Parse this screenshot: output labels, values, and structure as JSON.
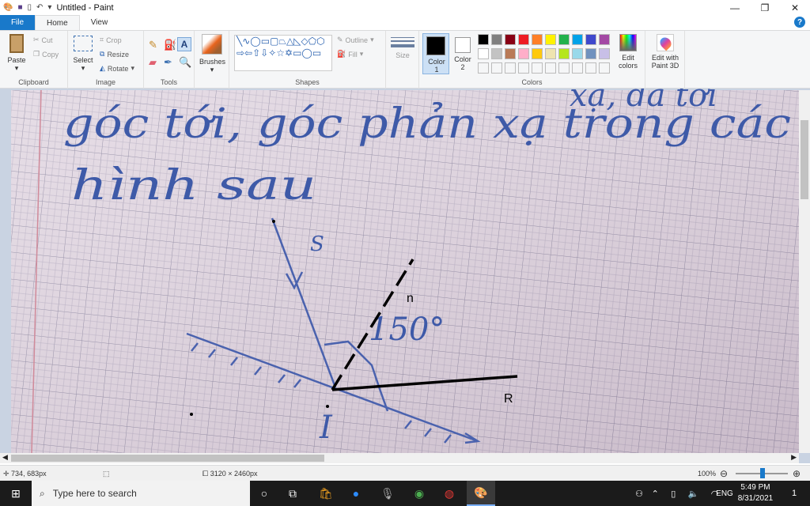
{
  "window": {
    "title": "Untitled - Paint",
    "minimize": "—",
    "maximize": "❐",
    "close": "✕"
  },
  "tabs": [
    {
      "label": "File"
    },
    {
      "label": "Home"
    },
    {
      "label": "View"
    }
  ],
  "help": "?",
  "ribbon": {
    "clipboard": {
      "label": "Clipboard",
      "paste": "Paste",
      "cut": "Cut",
      "copy": "Copy"
    },
    "image": {
      "label": "Image",
      "select": "Select",
      "crop": "Crop",
      "resize": "Resize",
      "rotate": "Rotate"
    },
    "tools": {
      "label": "Tools"
    },
    "brushes": {
      "label": "Brushes"
    },
    "shapes": {
      "label": "Shapes",
      "outline": "Outline",
      "fill": "Fill",
      "glyphs": "╲∿◯▭▢⏢△◺◇⬠⬡⇨⇦⇧⇩✧☆✡▭◯▭"
    },
    "size": {
      "label": "Size"
    },
    "colors": {
      "label": "Colors",
      "color1": "Color 1",
      "color2": "Color 2",
      "edit": "Edit colors",
      "palette_row1": [
        "#000000",
        "#7f7f7f",
        "#880015",
        "#ed1c24",
        "#ff7f27",
        "#fff200",
        "#22b14c",
        "#00a2e8",
        "#3f48cc",
        "#a349a4"
      ],
      "palette_row2": [
        "#ffffff",
        "#c3c3c3",
        "#b97a57",
        "#ffaec9",
        "#ffc90e",
        "#efe4b0",
        "#b5e61d",
        "#99d9ea",
        "#7092be",
        "#c8bfe7"
      ],
      "color1_value": "#000000",
      "color2_value": "#ffffff"
    },
    "paint3d": {
      "label": "Edit with Paint 3D"
    }
  },
  "canvas": {
    "handwriting": {
      "line1": "góc tới, góc phản xạ trong các",
      "line1b": "xạ, đã tới",
      "line2": "hình sau",
      "s": "S",
      "angle": "150°",
      "i": "I"
    },
    "labels": {
      "n": "n",
      "r": "R"
    }
  },
  "status": {
    "cursor": "734, 683px",
    "size": "3120 × 2460px",
    "zoom": "100%"
  },
  "taskbar": {
    "search_placeholder": "Type here to search",
    "time": "5:49 PM",
    "date": "8/31/2021",
    "lang": "ENG",
    "notif": "1"
  }
}
